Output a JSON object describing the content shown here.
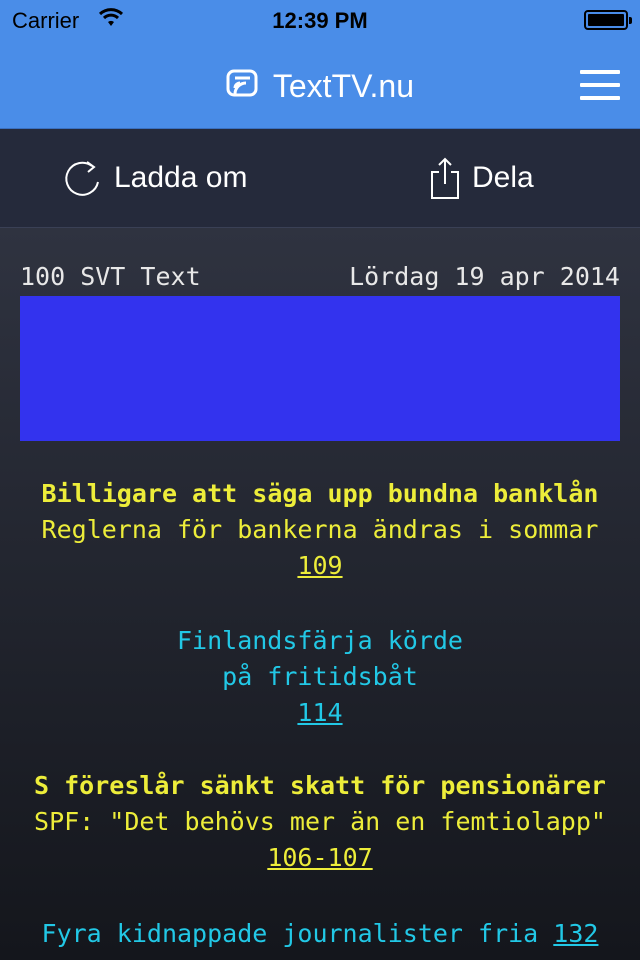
{
  "status_bar": {
    "carrier": "Carrier",
    "time": "12:39 PM"
  },
  "nav": {
    "title": "TextTV.nu",
    "menu_icon": "hamburger-menu-icon"
  },
  "toolbar": {
    "reload_label": "Ladda om",
    "share_label": "Dela"
  },
  "page": {
    "header_left": "100 SVT Text",
    "header_right": "Lördag 19 apr 2014",
    "banner_color": "#3333ee",
    "items": [
      {
        "headline": "Billigare att säga upp bundna banklån",
        "sub": "Reglerna för bankerna ändras i sommar",
        "link": "109"
      },
      {
        "line1": "Finlandsfärja körde",
        "line2": "på fritidsbåt",
        "link": "114"
      },
      {
        "headline": "S föreslår sänkt skatt för pensionärer",
        "sub": "SPF: \"Det behövs mer än en femtiolapp\"",
        "link": "106-107"
      },
      {
        "text": "Fyra kidnappade journalister fria",
        "link": "132"
      }
    ]
  },
  "colors": {
    "nav_bg": "#4a8de8",
    "toolbar_bg": "#252a3b",
    "yellow": "#eded3a",
    "cyan": "#22c8e6"
  }
}
